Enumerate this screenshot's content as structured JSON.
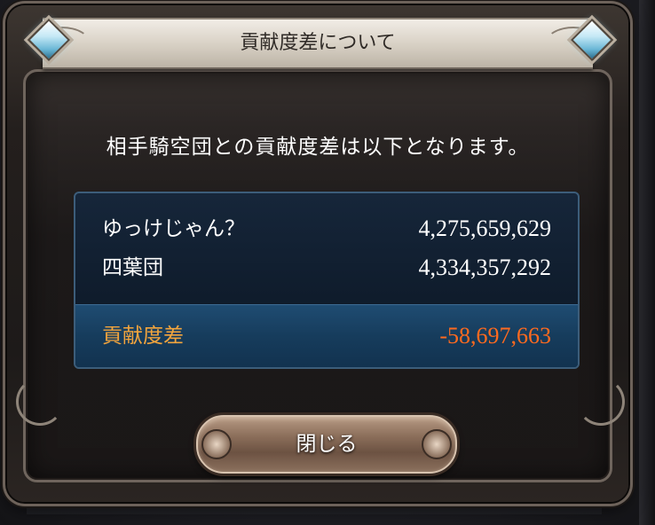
{
  "dialog": {
    "title": "貢献度差について",
    "message": "相手騎空団との貢献度差は以下となります。",
    "rows": [
      {
        "name": "ゆっけじゃん？",
        "value": "4,275,659,629"
      },
      {
        "name": "四葉団",
        "value": "4,334,357,292"
      }
    ],
    "difference": {
      "label": "貢献度差",
      "value": "-58,697,663"
    },
    "close_label": "閉じる"
  },
  "colors": {
    "difference_label": "#f3a53d",
    "difference_value": "#ff6a1f",
    "panel_background": "#0f1c2c",
    "difference_band": "#1f4c72"
  },
  "icons": [
    "diamond-gem-icon"
  ]
}
